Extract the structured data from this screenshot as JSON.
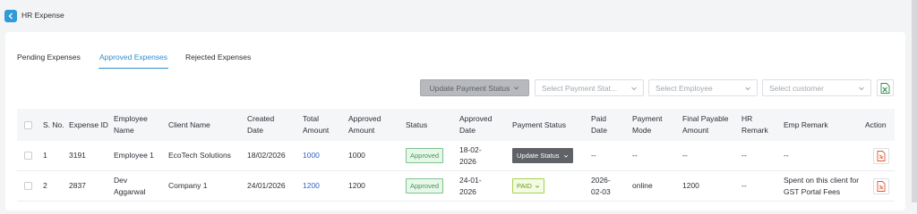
{
  "header": {
    "title": "HR Expense"
  },
  "tabs": [
    {
      "label": "Pending Expenses"
    },
    {
      "label": "Approved Expenses"
    },
    {
      "label": "Rejected Expenses"
    }
  ],
  "toolbar": {
    "update_payment_label": "Update Payment Status",
    "payment_status_placeholder": "Select Payment Stat...",
    "employee_placeholder": "Select Employee",
    "customer_placeholder": "Select customer"
  },
  "table": {
    "headers": {
      "sno": "S. No.",
      "expense_id": "Expense ID",
      "employee_name": "Employee Name",
      "client_name": "Client Name",
      "created_date": "Created Date",
      "total_amount": "Total Amount",
      "approved_amount": "Approved Amount",
      "status": "Status",
      "approved_date": "Approved Date",
      "payment_status": "Payment Status",
      "paid_date": "Paid Date",
      "payment_mode": "Payment Mode",
      "final_payable": "Final Payable Amount",
      "hr_remark": "HR Remark",
      "emp_remark": "Emp Remark",
      "action": "Action"
    },
    "rows": [
      {
        "sno": "1",
        "expense_id": "3191",
        "employee_name": "Employee 1",
        "client_name": "EcoTech Solutions",
        "created_date": "18/02/2026",
        "total_amount": "1000",
        "approved_amount": "1000",
        "status": "Approved",
        "approved_date": "18-02-2026",
        "payment_status": "Update Status",
        "paid_date": "--",
        "payment_mode": "--",
        "final_payable": "--",
        "hr_remark": "--",
        "emp_remark": "--"
      },
      {
        "sno": "2",
        "expense_id": "2837",
        "employee_name": "Dev Aggarwal",
        "client_name": "Company 1",
        "created_date": "24/01/2026",
        "total_amount": "1200",
        "approved_amount": "1200",
        "status": "Approved",
        "approved_date": "24-01-2026",
        "payment_status": "PAID",
        "paid_date": "2026-02-03",
        "payment_mode": "online",
        "final_payable": "1200",
        "hr_remark": "--",
        "emp_remark": "Spent on this client for GST Portal Fees"
      }
    ]
  },
  "colors": {
    "accent": "#2e8fcb",
    "approved": "#3f9a4f",
    "paid": "#6c9a1a",
    "link": "#2e63c4"
  }
}
